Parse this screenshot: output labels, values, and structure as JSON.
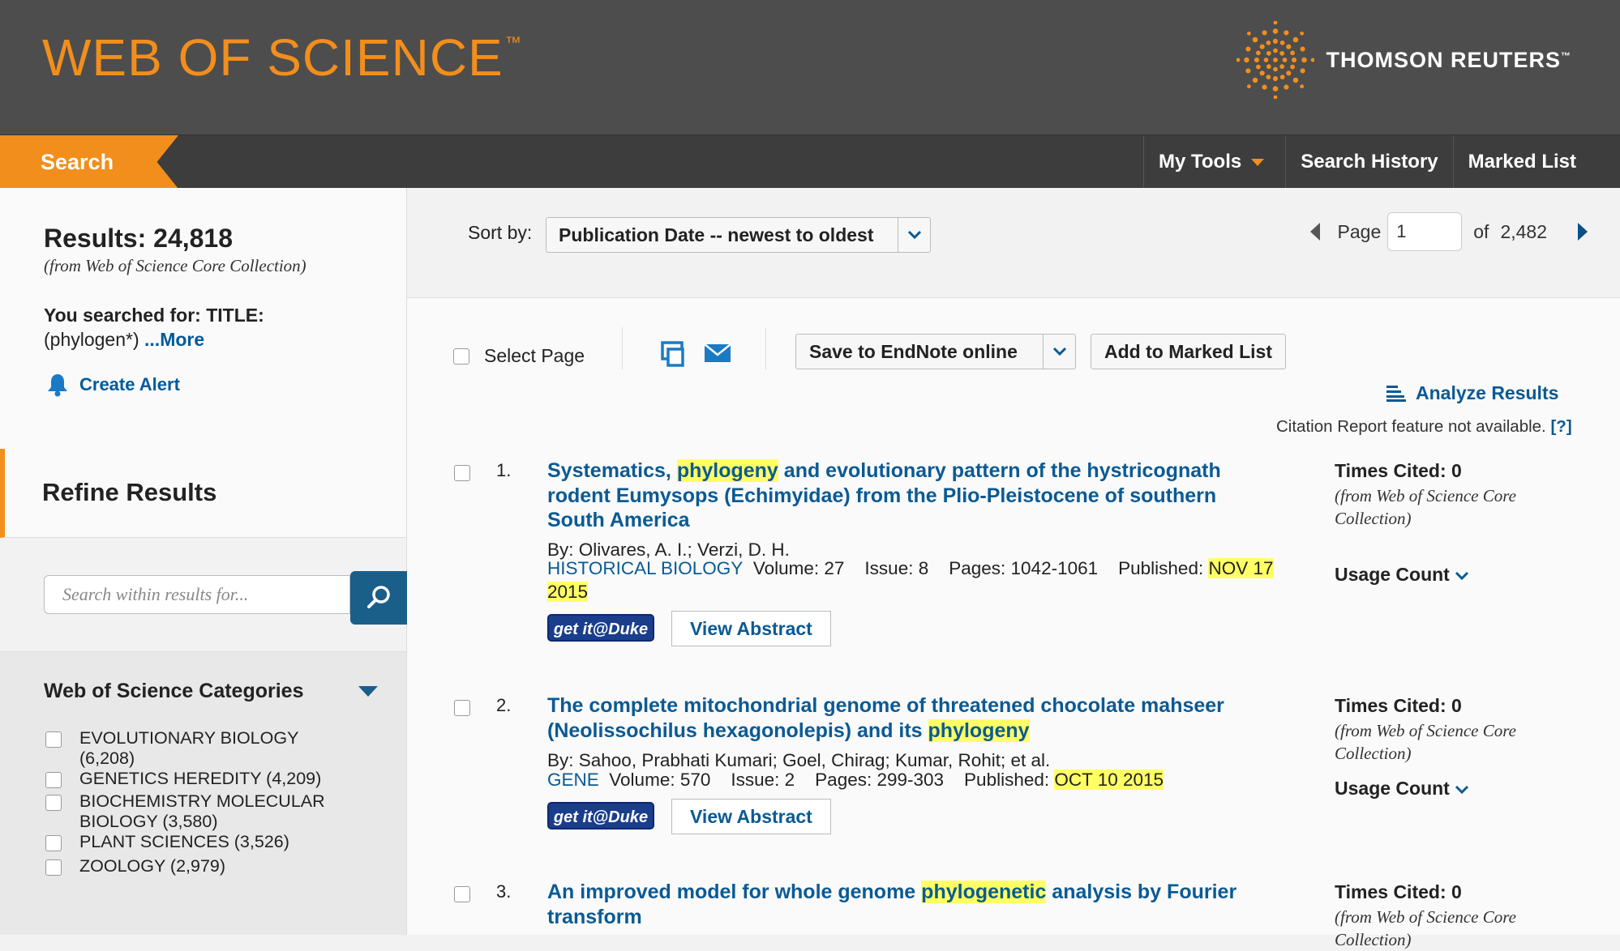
{
  "header": {
    "logo": "WEB OF SCIENCE",
    "logo_tm": "™",
    "brand": "THOMSON REUTERS",
    "brand_tm": "™"
  },
  "nav": {
    "search_tab": "Search",
    "links": [
      "My Tools",
      "Search History",
      "Marked List"
    ]
  },
  "sidebar": {
    "results_label": "Results: 24,818",
    "results_source": "(from Web of Science Core Collection)",
    "searched_prefix": "You searched for: TITLE:",
    "searched_query": "(phylogen*)",
    "more_link": "...More",
    "create_alert": "Create Alert",
    "refine_title": "Refine Results",
    "within_placeholder": "Search within results for...",
    "categories_title": "Web of Science Categories",
    "categories": [
      {
        "label": "EVOLUTIONARY BIOLOGY (6,208)"
      },
      {
        "label": "GENETICS HEREDITY (4,209)"
      },
      {
        "label": "BIOCHEMISTRY MOLECULAR BIOLOGY (3,580)"
      },
      {
        "label": "PLANT SCIENCES (3,526)"
      },
      {
        "label": "ZOOLOGY (2,979)"
      }
    ]
  },
  "sortbar": {
    "sort_label": "Sort by:",
    "sort_value": "Publication Date -- newest to oldest",
    "page_label": "Page",
    "page_value": "1",
    "of_label": "of",
    "total_pages": "2,482"
  },
  "toolbar": {
    "select_page": "Select Page",
    "save_endnote": "Save to EndNote online",
    "add_marked": "Add to Marked List",
    "analyze": "Analyze Results",
    "citation_note": "Citation Report feature not available.",
    "citation_help": "[?]"
  },
  "records": [
    {
      "num": "1.",
      "title_pre": "Systematics, ",
      "title_hl": "phylogeny",
      "title_post": " and evolutionary pattern of the hystricognath rodent Eumysops (Echimyidae) from the Plio-Pleistocene of southern South America",
      "authors": "By: Olivares, A. I.; Verzi, D. H.",
      "journal": "HISTORICAL BIOLOGY",
      "details": "Volume: 27    Issue: 8    Pages: 1042-1061    Published: ",
      "date": "NOV 17 2015",
      "getit": "get it@Duke",
      "view_abstract": "View Abstract",
      "times_cited": "Times Cited: 0",
      "tc_source": "(from Web of Science Core Collection)",
      "usage": "Usage Count"
    },
    {
      "num": "2.",
      "title_pre": "The complete mitochondrial genome of threatened chocolate mahseer (Neolissochilus hexagonolepis) and its ",
      "title_hl": "phylogeny",
      "title_post": "",
      "authors": "By: Sahoo, Prabhati Kumari; Goel, Chirag; Kumar, Rohit; et al.",
      "journal": "GENE",
      "details": "Volume: 570    Issue: 2    Pages: 299-303    Published: ",
      "date": "OCT 10 2015",
      "getit": "get it@Duke",
      "view_abstract": "View Abstract",
      "times_cited": "Times Cited: 0",
      "tc_source": "(from Web of Science Core Collection)",
      "usage": "Usage Count"
    },
    {
      "num": "3.",
      "title_pre": "An improved model for whole genome ",
      "title_hl": "phylogenetic",
      "title_post": " analysis by Fourier transform",
      "times_cited": "Times Cited: 0",
      "tc_source": "(from Web of Science Core Collection)"
    }
  ],
  "colors": {
    "accent": "#f28e1c",
    "link": "#0a5a94",
    "header_bg": "#4d4d4d",
    "highlight": "#ffff66"
  }
}
